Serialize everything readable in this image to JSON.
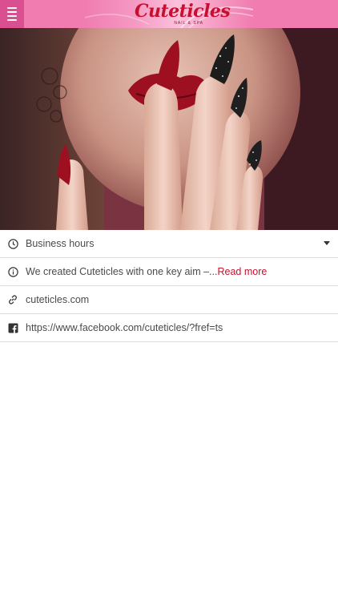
{
  "header": {
    "logo_text": "Cuteticles",
    "logo_subtext": "NAIL & SPA",
    "menu_icon": "hamburger-menu-icon",
    "accent_color": "#f07cb0",
    "menu_button_color": "#d94f8f"
  },
  "hero": {
    "image": "nails-model-photo"
  },
  "info": {
    "hours": {
      "label": "Business hours",
      "icon": "clock-icon"
    },
    "about": {
      "text": "We created Cuteticles with one key aim –...",
      "read_more": "Read more",
      "icon": "info-icon"
    },
    "website": {
      "label": "cuteticles.com",
      "icon": "link-icon"
    },
    "facebook": {
      "label": "https://www.facebook.com/cuteticles/?fref=ts",
      "icon": "facebook-icon"
    }
  },
  "colors": {
    "link": "#c8102e",
    "divider": "#dcdcdc"
  }
}
